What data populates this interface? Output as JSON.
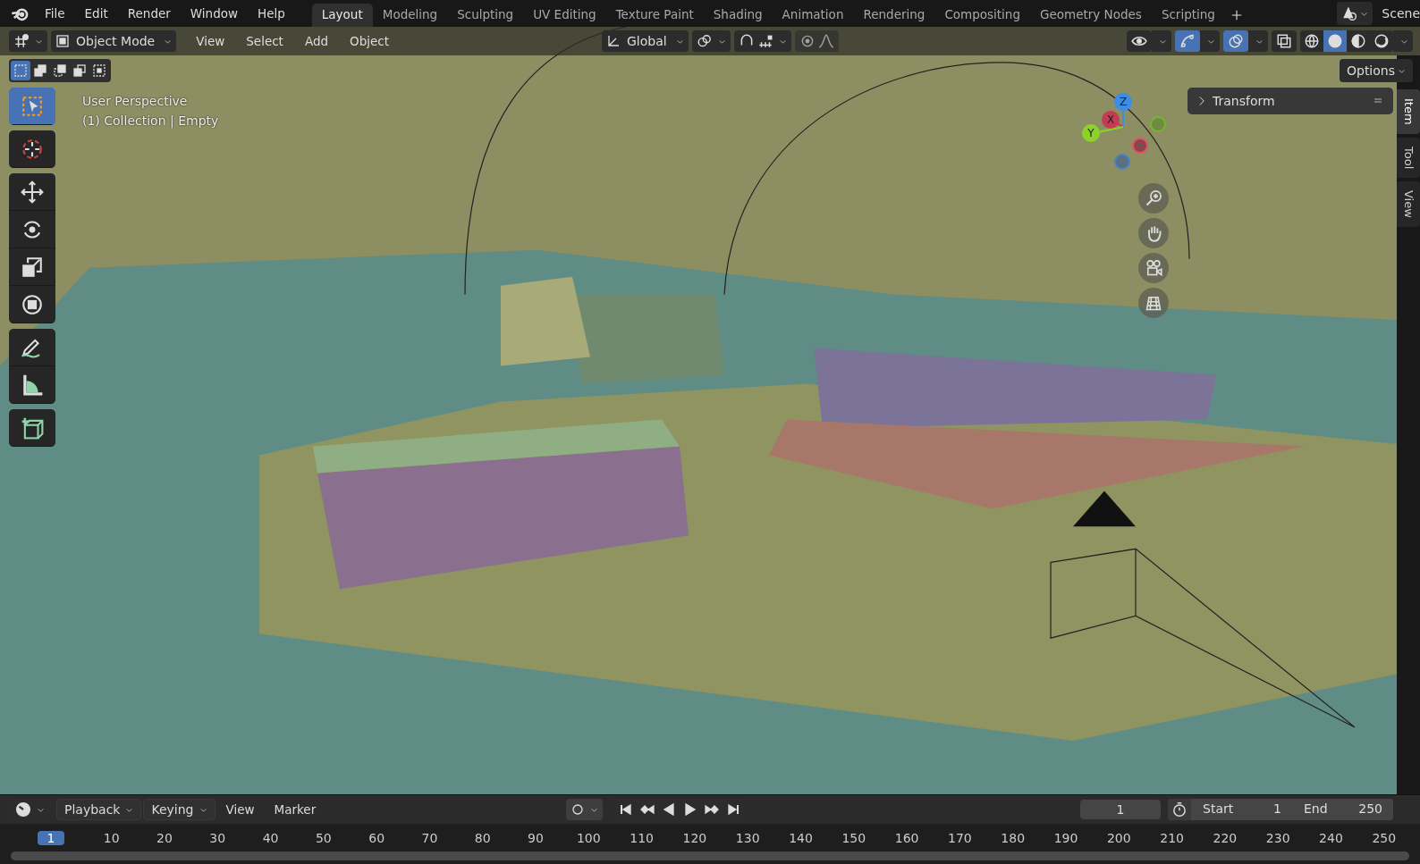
{
  "top_menu": [
    "File",
    "Edit",
    "Render",
    "Window",
    "Help"
  ],
  "workspaces": [
    {
      "label": "Layout",
      "selected": true
    },
    {
      "label": "Modeling",
      "selected": false
    },
    {
      "label": "Sculpting",
      "selected": false
    },
    {
      "label": "UV Editing",
      "selected": false
    },
    {
      "label": "Texture Paint",
      "selected": false
    },
    {
      "label": "Shading",
      "selected": false
    },
    {
      "label": "Animation",
      "selected": false
    },
    {
      "label": "Rendering",
      "selected": false
    },
    {
      "label": "Compositing",
      "selected": false
    },
    {
      "label": "Geometry Nodes",
      "selected": false
    },
    {
      "label": "Scripting",
      "selected": false
    }
  ],
  "scene": {
    "label": "Scene"
  },
  "header": {
    "mode": "Object Mode",
    "menus": [
      "View",
      "Select",
      "Add",
      "Object"
    ],
    "orientation": "Global",
    "toggles": [
      {
        "kind": "visibility",
        "on": false
      },
      {
        "kind": "gizmo",
        "on": true
      },
      {
        "kind": "overlay",
        "on": true
      },
      {
        "kind": "xray",
        "on": false
      }
    ],
    "shading": [
      {
        "kind": "wireframe",
        "selected": false
      },
      {
        "kind": "solid",
        "selected": true
      },
      {
        "kind": "material",
        "selected": false
      },
      {
        "kind": "rendered",
        "selected": false
      }
    ]
  },
  "select_modes": [
    {
      "kind": "new",
      "selected": true
    },
    {
      "kind": "extend",
      "selected": false
    },
    {
      "kind": "subtract",
      "selected": false
    },
    {
      "kind": "invert",
      "selected": false
    },
    {
      "kind": "intersect",
      "selected": false
    }
  ],
  "options": {
    "label": "Options"
  },
  "viewport": {
    "lines": [
      "User Perspective",
      "(1) Collection | Empty"
    ]
  },
  "tool_groups": [
    [
      {
        "kind": "select",
        "selected": true
      }
    ],
    [
      {
        "kind": "cursor",
        "selected": false
      }
    ],
    [
      {
        "kind": "move",
        "selected": false
      },
      {
        "kind": "rotate",
        "selected": false
      },
      {
        "kind": "scale",
        "selected": false
      },
      {
        "kind": "transform",
        "selected": false
      }
    ],
    [
      {
        "kind": "annotate",
        "selected": false
      },
      {
        "kind": "measure",
        "selected": false
      }
    ],
    [
      {
        "kind": "add-cube",
        "selected": false
      }
    ]
  ],
  "transform_panel": {
    "title": "Transform",
    "expanded": false
  },
  "axes": [
    {
      "label": "Z",
      "kind": "z"
    },
    {
      "label": "X",
      "kind": "x"
    },
    {
      "label": "Y",
      "kind": "y"
    }
  ],
  "sidebar_tabs": [
    {
      "label": "Item",
      "selected": true
    },
    {
      "label": "Tool",
      "selected": false
    },
    {
      "label": "View",
      "selected": false
    }
  ],
  "timeline": {
    "menus": [
      {
        "label": "Playback",
        "dropdown": true
      },
      {
        "label": "Keying",
        "dropdown": true
      },
      {
        "label": "View",
        "dropdown": false
      },
      {
        "label": "Marker",
        "dropdown": false
      }
    ],
    "auto_key": false,
    "current_frame": "1",
    "start_label": "Start",
    "start": "1",
    "end_label": "End",
    "end": "250",
    "ruler": [
      {
        "label": "1",
        "selected": true
      },
      {
        "label": "10",
        "selected": false
      },
      {
        "label": "20",
        "selected": false
      },
      {
        "label": "30",
        "selected": false
      },
      {
        "label": "40",
        "selected": false
      },
      {
        "label": "50",
        "selected": false
      },
      {
        "label": "60",
        "selected": false
      },
      {
        "label": "70",
        "selected": false
      },
      {
        "label": "80",
        "selected": false
      },
      {
        "label": "90",
        "selected": false
      },
      {
        "label": "100",
        "selected": false
      },
      {
        "label": "110",
        "selected": false
      },
      {
        "label": "120",
        "selected": false
      },
      {
        "label": "130",
        "selected": false
      },
      {
        "label": "140",
        "selected": false
      },
      {
        "label": "150",
        "selected": false
      },
      {
        "label": "160",
        "selected": false
      },
      {
        "label": "170",
        "selected": false
      },
      {
        "label": "180",
        "selected": false
      },
      {
        "label": "190",
        "selected": false
      },
      {
        "label": "200",
        "selected": false
      },
      {
        "label": "210",
        "selected": false
      },
      {
        "label": "220",
        "selected": false
      },
      {
        "label": "230",
        "selected": false
      },
      {
        "label": "240",
        "selected": false
      },
      {
        "label": "250",
        "selected": false
      }
    ]
  }
}
